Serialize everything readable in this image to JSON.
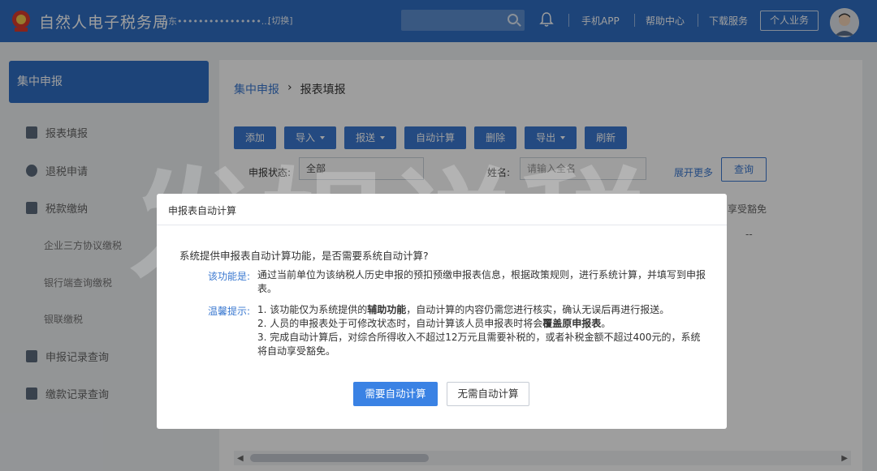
{
  "header": {
    "brand": "自然人电子税务局",
    "region": "山东••••••••••••••••...",
    "switch_label": "[切换]",
    "links": [
      "手机APP",
      "帮助中心",
      "下载服务"
    ],
    "personal_button": "个人业务"
  },
  "sidebar": {
    "head": "集中申报",
    "items": [
      "报表填报",
      "退税申请",
      "税款缴纳"
    ],
    "subitems": [
      "企业三方协议缴税",
      "银行端查询缴税",
      "银联缴税"
    ],
    "items2": [
      "申报记录查询",
      "缴款记录查询"
    ]
  },
  "main": {
    "breadcrumb": [
      "集中申报",
      "报表填报"
    ],
    "toolbar": [
      "添加",
      "导入",
      "报送",
      "自动计算",
      "删除",
      "导出",
      "刷新"
    ],
    "filters": {
      "status_label": "申报状态:",
      "status_value": "全部",
      "name_label": "姓名:",
      "name_placeholder": "请输入全名"
    },
    "more_label": "展开更多",
    "query_label": "查询",
    "column_header": "享受豁免",
    "dash": "--"
  },
  "modal": {
    "title": "申报表自动计算",
    "question": "系统提供申报表自动计算功能，是否需要系统自动计算?",
    "feature_label": "该功能是:",
    "feature_text": "通过当前单位为该纳税人历史申报的预扣预缴申报表信息，根据政策规则，进行系统计算，并填写到申报表。",
    "tip_label": "温馨提示:",
    "tips": [
      {
        "pre": "1. 该功能仅为系统提供的",
        "bold": "辅助功能",
        "post": "，自动计算的内容仍需您进行核实，确认无误后再进行报送。"
      },
      {
        "pre": "2. 人员的申报表处于可修改状态时，自动计算该人员申报表时将会",
        "bold": "覆盖原申报表",
        "post": "。"
      },
      {
        "pre": "3. 完成自动计算后，对综合所得收入不超过12万元且需要补税的，或者补税金额不超过400元的，系统将自动享受豁免。",
        "bold": "",
        "post": ""
      }
    ],
    "primary_button": "需要自动计算",
    "secondary_button": "无需自动计算"
  },
  "watermark": "发姐说税",
  "colors": {
    "primary": "#2f6fc4",
    "accent": "#3a82e4"
  }
}
